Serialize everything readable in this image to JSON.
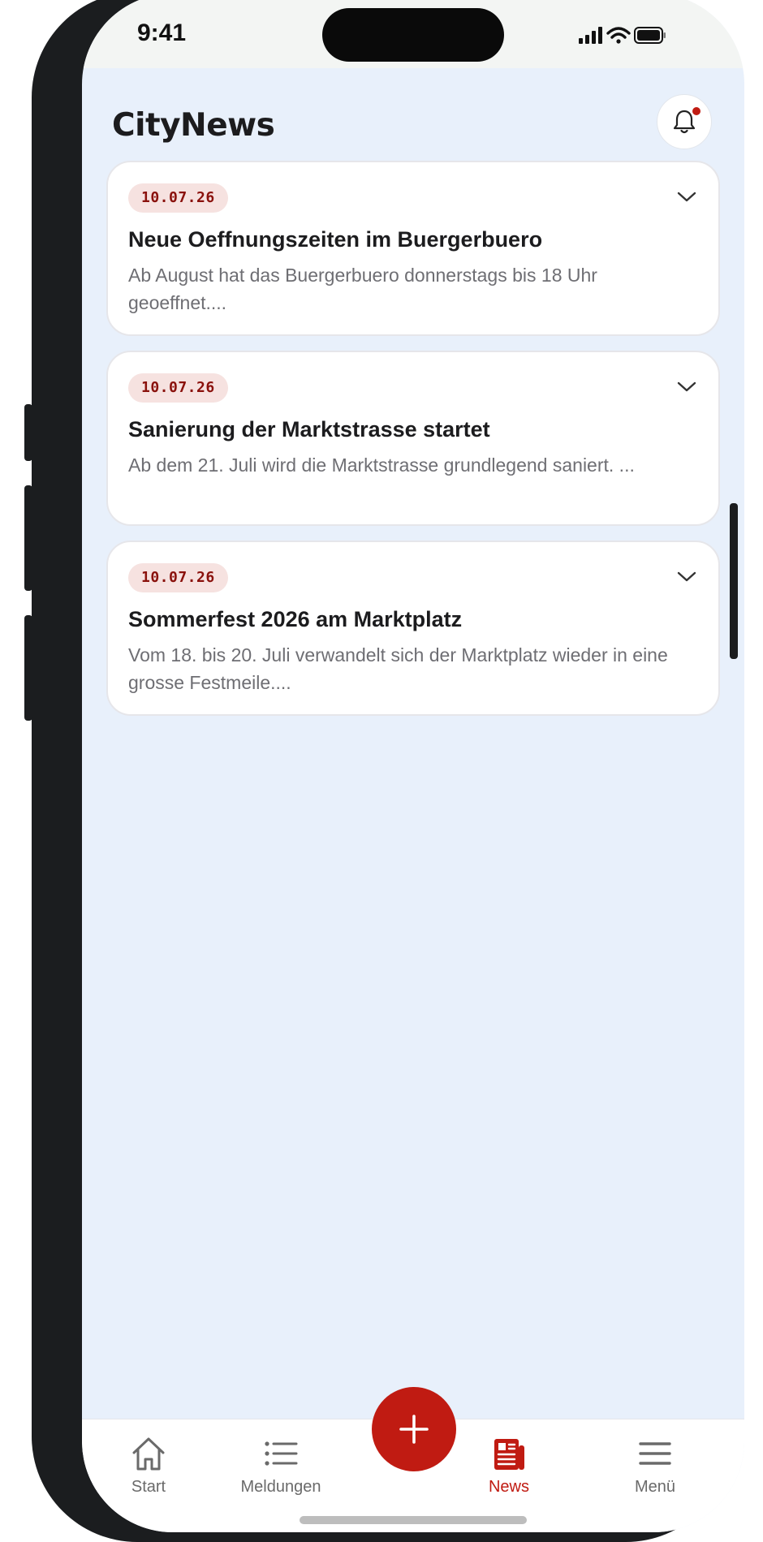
{
  "status": {
    "time": "9:41",
    "icons": [
      "signal-icon",
      "wifi-icon",
      "battery-icon"
    ]
  },
  "header": {
    "title": "CityNews",
    "notification_icon": "bell-icon",
    "has_unread": true
  },
  "news": [
    {
      "date": "10.07.26",
      "title": "Neue Oeffnungszeiten im Buergerbuero",
      "excerpt": "Ab August hat das Buergerbuero donnerstags bis 18 Uhr geoeffnet...."
    },
    {
      "date": "10.07.26",
      "title": "Sanierung der Marktstrasse startet",
      "excerpt": "Ab dem 21. Juli wird die Marktstrasse grundlegend saniert. ..."
    },
    {
      "date": "10.07.26",
      "title": "Sommerfest 2026 am Marktplatz",
      "excerpt": "Vom 18. bis 20. Juli verwandelt sich der Marktplatz wieder in eine grosse Festmeile...."
    }
  ],
  "tabbar": {
    "items": [
      {
        "label": "Start",
        "icon": "home-icon"
      },
      {
        "label": "Meldungen",
        "icon": "list-icon"
      },
      {
        "label": "News",
        "icon": "newspaper-icon",
        "active": true
      },
      {
        "label": "Menü",
        "icon": "menu-icon"
      }
    ],
    "fab_icon": "plus-icon"
  },
  "colors": {
    "accent": "#c01b12",
    "background": "#e8f0fb",
    "badge_bg": "#f6e2e0",
    "badge_text": "#8a110c"
  }
}
